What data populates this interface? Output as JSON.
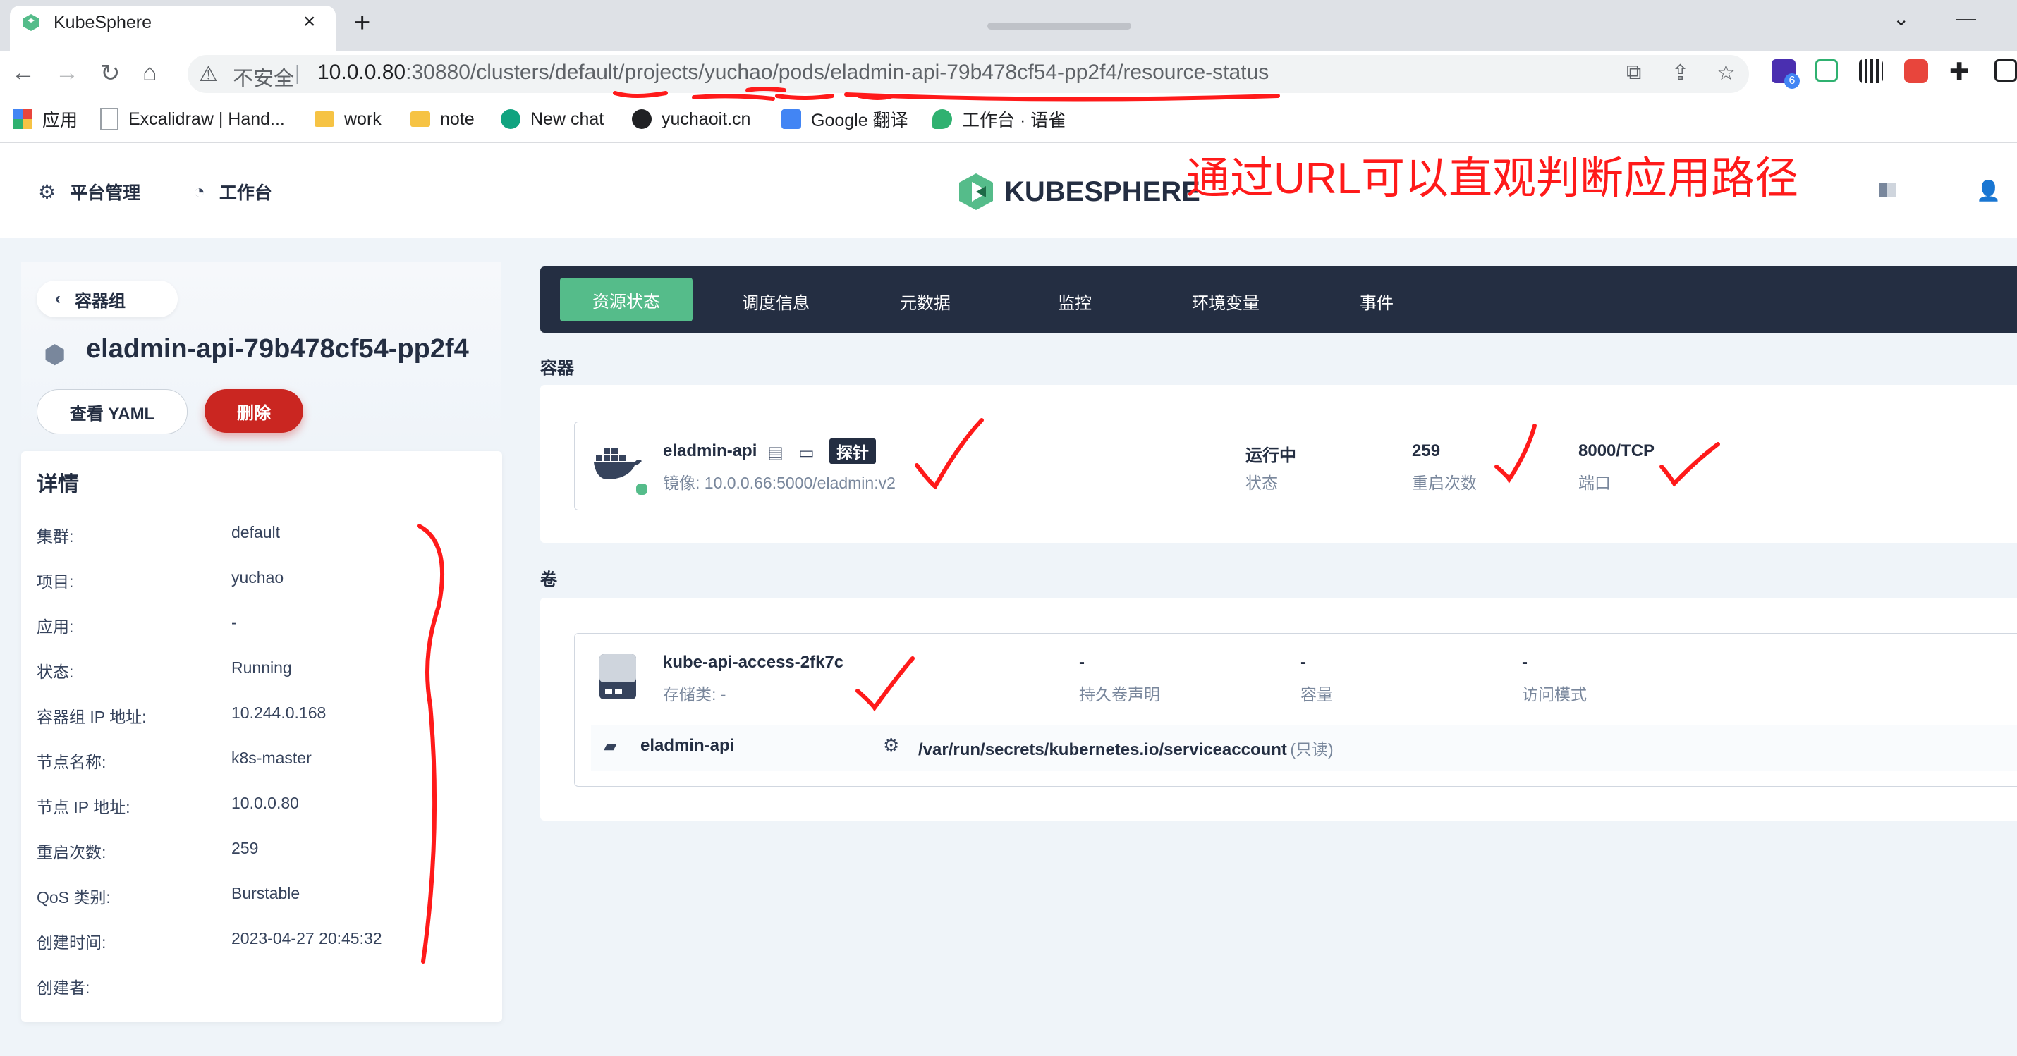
{
  "browser": {
    "tab_title": "KubeSphere",
    "tab_close": "×",
    "new_tab": "+",
    "insecure_label": "不安全",
    "separator": "|",
    "url_host": "10.0.0.80",
    "url_port_path": ":30880/clusters/default/projects/yuchao/pods/eladmin-api-79b478cf54-pp2f4/resource-status",
    "extension_badge": "6",
    "bookmarks": [
      {
        "label": "应用",
        "icon": "apps-grid-icon",
        "color": "#e8453c"
      },
      {
        "label": "Excalidraw | Hand...",
        "icon": "page-icon",
        "color": "#9aa0a6"
      },
      {
        "label": "work",
        "icon": "folder-icon",
        "color": "#f6c344"
      },
      {
        "label": "note",
        "icon": "folder-icon",
        "color": "#f6c344"
      },
      {
        "label": "New chat",
        "icon": "openai-icon",
        "color": "#10a37f"
      },
      {
        "label": "yuchaoit.cn",
        "icon": "github-icon",
        "color": "#202124"
      },
      {
        "label": "Google 翻译",
        "icon": "translate-icon",
        "color": "#4285f4"
      },
      {
        "label": "工作台 · 语雀",
        "icon": "yuque-icon",
        "color": "#2fb170"
      }
    ]
  },
  "header": {
    "platform_admin": "平台管理",
    "workbench": "工作台",
    "logo_text": "KUBESPHERE",
    "annotation": "通过URL可以直观判断应用路径"
  },
  "left": {
    "back_label": "容器组",
    "pod_name": "eladmin-api-79b478cf54-pp2f4",
    "view_yaml": "查看 YAML",
    "delete": "删除",
    "details_title": "详情",
    "details": [
      {
        "label": "集群:",
        "value": "default"
      },
      {
        "label": "项目:",
        "value": "yuchao"
      },
      {
        "label": "应用:",
        "value": "-"
      },
      {
        "label": "状态:",
        "value": "Running"
      },
      {
        "label": "容器组 IP 地址:",
        "value": "10.244.0.168"
      },
      {
        "label": "节点名称:",
        "value": "k8s-master"
      },
      {
        "label": "节点 IP 地址:",
        "value": "10.0.0.80"
      },
      {
        "label": "重启次数:",
        "value": "259"
      },
      {
        "label": "QoS 类别:",
        "value": "Burstable"
      },
      {
        "label": "创建时间:",
        "value": "2023-04-27 20:45:32"
      },
      {
        "label": "创建者:",
        "value": ""
      }
    ]
  },
  "tabs": [
    "资源状态",
    "调度信息",
    "元数据",
    "监控",
    "环境变量",
    "事件"
  ],
  "containers": {
    "section_label": "容器",
    "name": "eladmin-api",
    "probe_label": "探针",
    "image": "镜像:  10.0.0.66:5000/eladmin:v2",
    "status_value": "运行中",
    "status_label": "状态",
    "restarts_value": "259",
    "restarts_label": "重启次数",
    "port_value": "8000/TCP",
    "port_label": "端口"
  },
  "volumes": {
    "section_label": "卷",
    "name": "kube-api-access-2fk7c",
    "storage_class": "存储类:  -",
    "pvc_value": "-",
    "pvc_label": "持久卷声明",
    "capacity_value": "-",
    "capacity_label": "容量",
    "access_value": "-",
    "access_label": "访问模式",
    "mount_container": "eladmin-api",
    "mount_path": "/var/run/secrets/kubernetes.io/serviceaccount",
    "mount_mode": "(只读)"
  },
  "colors": {
    "accent_green": "#55bc8a",
    "danger_red": "#ca2621",
    "dark_nav": "#242e42",
    "annotation_red": "#ff1a1a"
  }
}
